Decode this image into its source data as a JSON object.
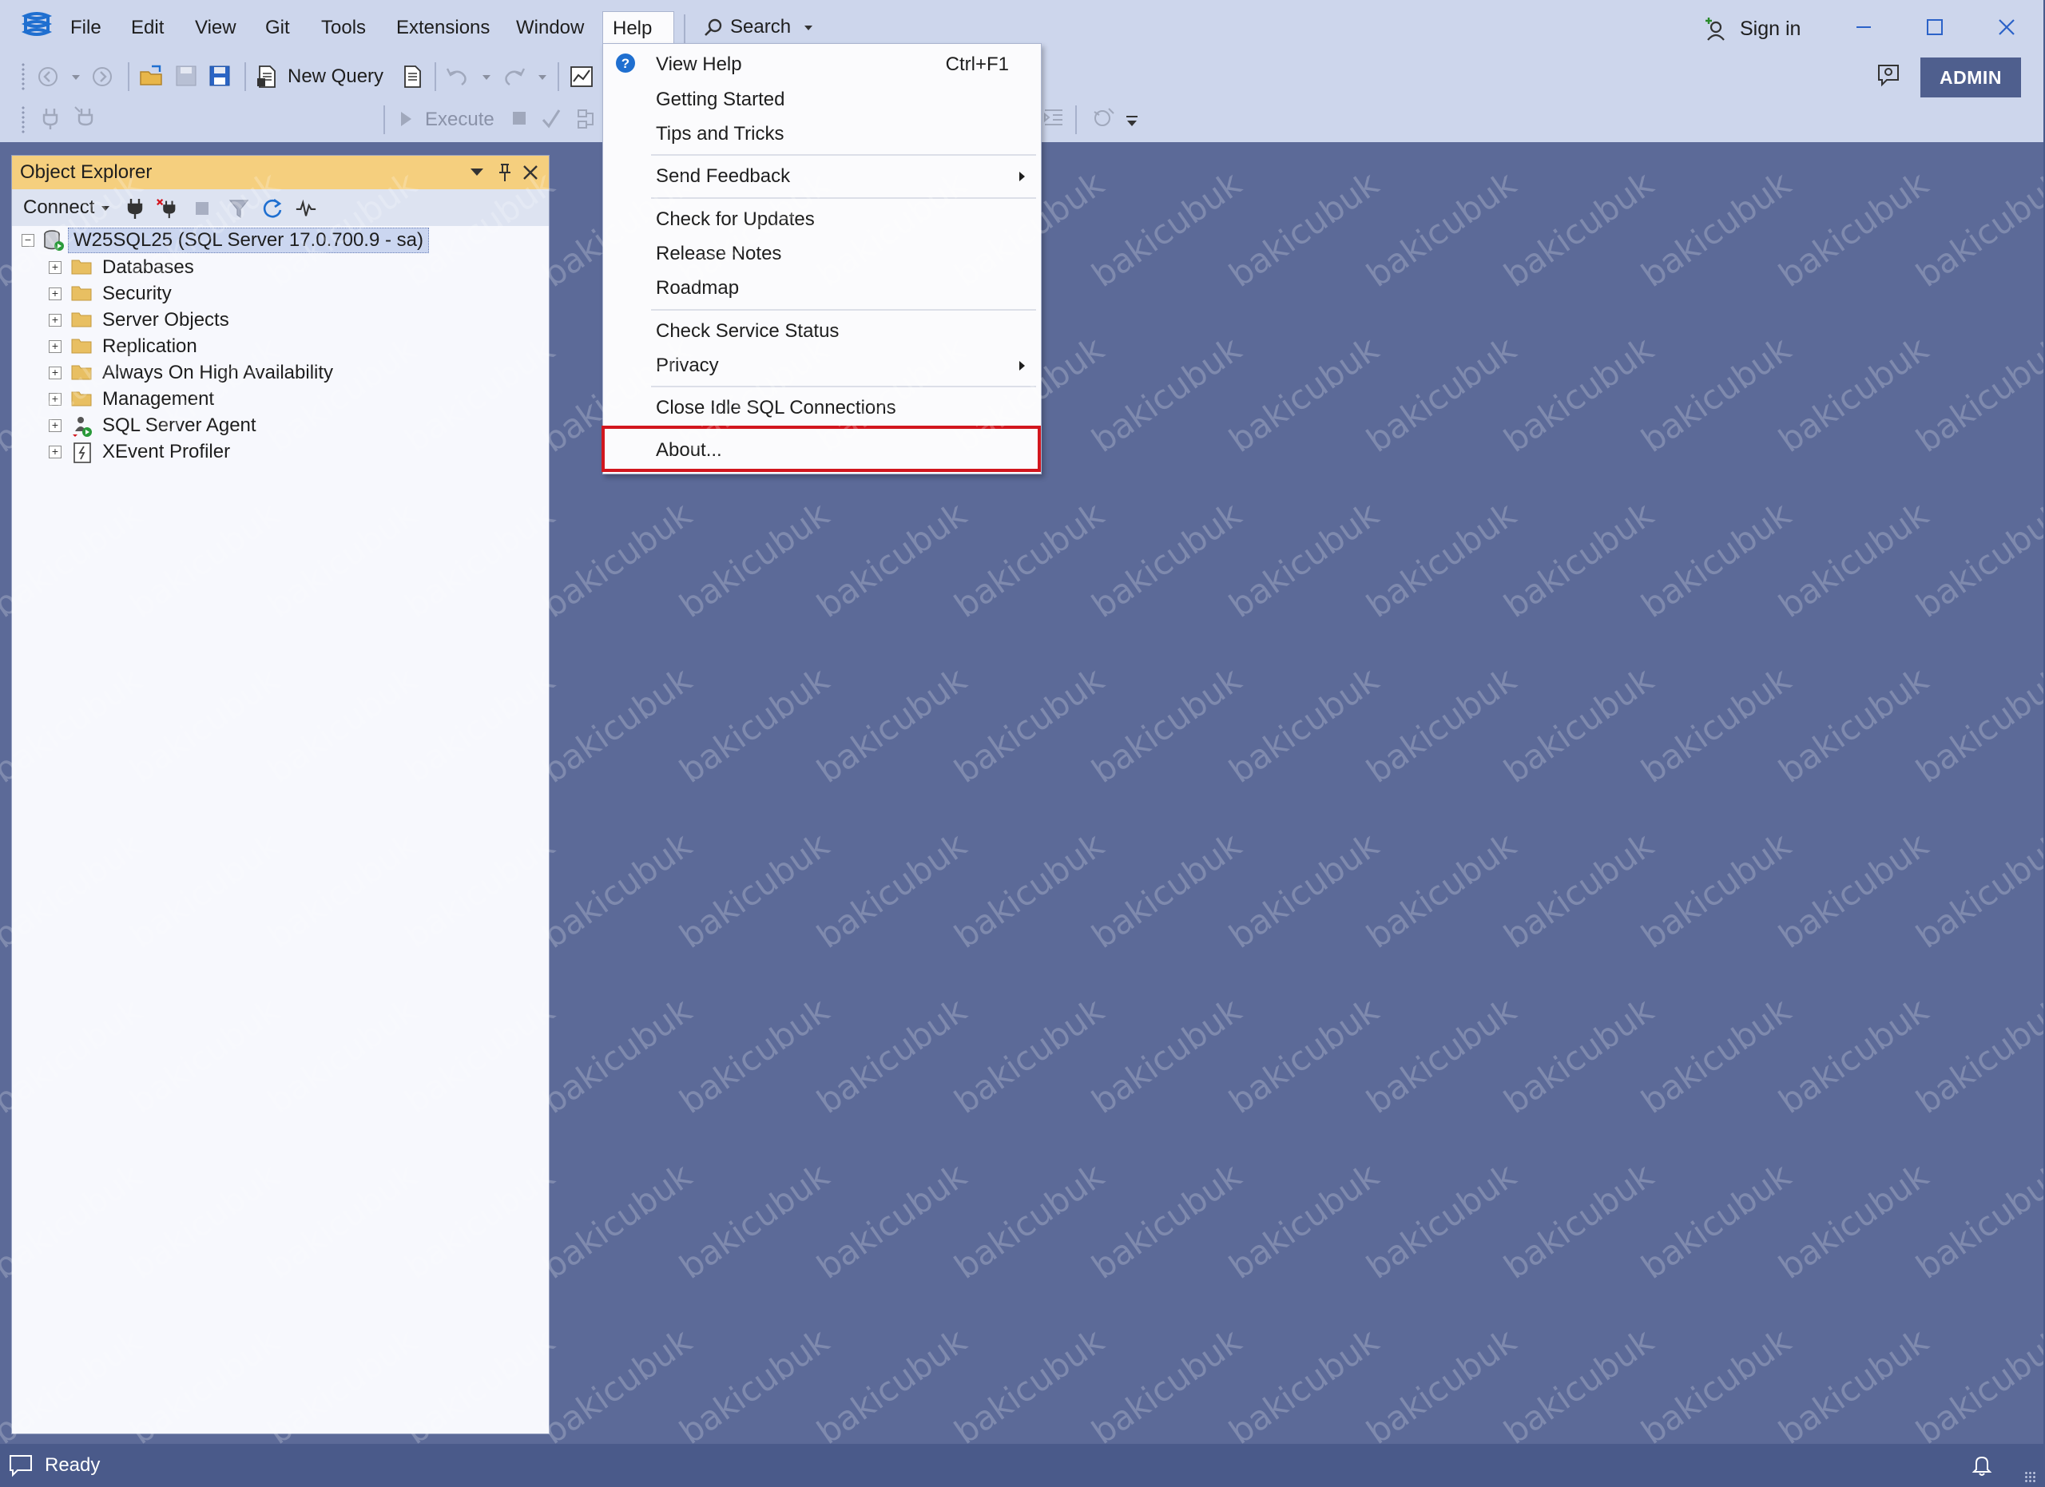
{
  "menubar": {
    "items": [
      "File",
      "Edit",
      "View",
      "Git",
      "Tools",
      "Extensions",
      "Window",
      "Help"
    ],
    "active": "Help",
    "search_label": "Search",
    "signin_label": "Sign in"
  },
  "toolbar": {
    "new_query_label": "New Query",
    "execute_label": "Execute",
    "database_combo_value": "",
    "admin_badge": "ADMIN"
  },
  "object_explorer": {
    "title": "Object Explorer",
    "connect_label": "Connect",
    "server_node": "W25SQL25 (SQL Server 17.0.700.9 - sa)",
    "children": [
      "Databases",
      "Security",
      "Server Objects",
      "Replication",
      "Always On High Availability",
      "Management",
      "SQL Server Agent",
      "XEvent Profiler"
    ]
  },
  "help_menu": {
    "items": [
      {
        "label": "View Help",
        "shortcut": "Ctrl+F1"
      },
      {
        "label": "Getting Started"
      },
      {
        "label": "Tips and Tricks"
      },
      {
        "label": "Send Feedback"
      },
      {
        "label": "Check for Updates"
      },
      {
        "label": "Release Notes"
      },
      {
        "label": "Roadmap"
      },
      {
        "label": "Check Service Status"
      },
      {
        "label": "Privacy"
      },
      {
        "label": "Close Idle SQL Connections"
      },
      {
        "label": "About..."
      }
    ]
  },
  "watermark": "bakicubuk",
  "statusbar": {
    "text": "Ready"
  },
  "colors": {
    "workspace": "#5c6a98",
    "chrome": "#cdd6ec",
    "explorer_header": "#f5cf7e",
    "highlight_border": "#d2161e",
    "statusbar": "#4a5a8a"
  }
}
